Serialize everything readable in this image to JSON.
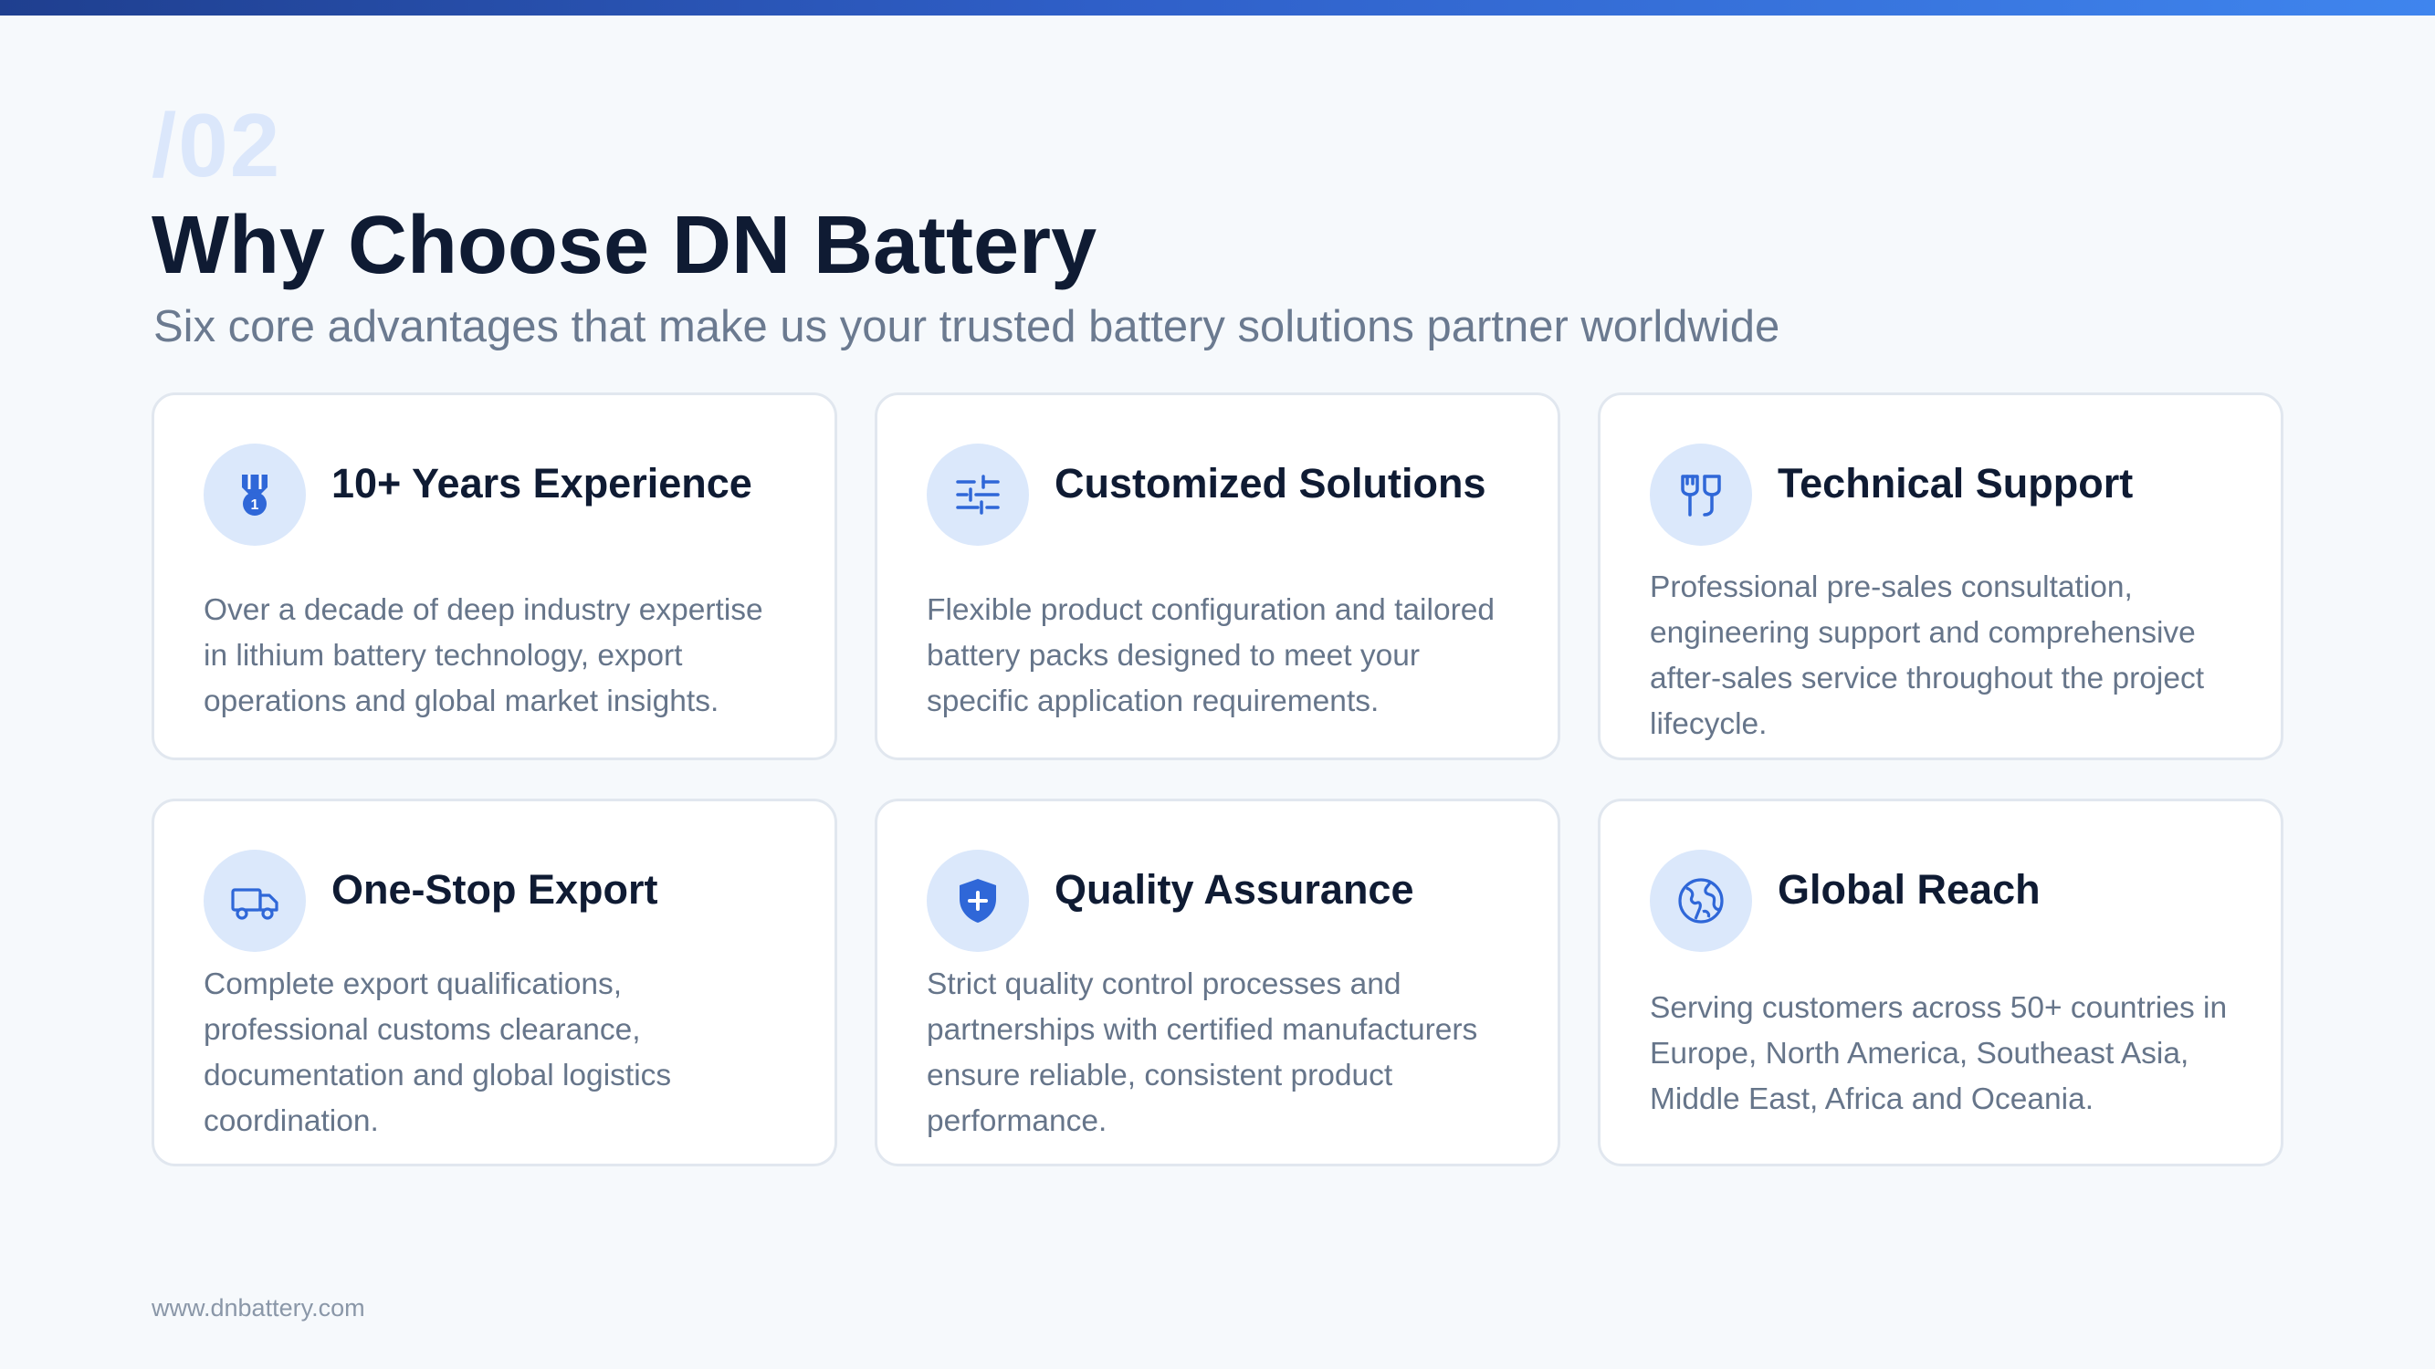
{
  "header": {
    "section_number": "/02",
    "title": "Why Choose DN Battery",
    "subtitle": "Six core advantages that make us your trusted battery solutions partner worldwide"
  },
  "cards": [
    {
      "icon": "medal-icon",
      "title": "10+ Years Experience",
      "description": "Over a decade of deep industry expertise in lithium battery technology, export operations and global market insights."
    },
    {
      "icon": "sliders-icon",
      "title": "Customized Solutions",
      "description": "Flexible product configuration and tailored battery packs designed to meet your specific application requirements."
    },
    {
      "icon": "plug-icon",
      "title": "Technical Support",
      "description": "Professional pre-sales consultation, engineering support and comprehensive after-sales service throughout the project lifecycle."
    },
    {
      "icon": "truck-icon",
      "title": "One-Stop Export",
      "description": "Complete export qualifications, professional customs clearance, documentation and global logistics coordination."
    },
    {
      "icon": "shield-plus-icon",
      "title": "Quality Assurance",
      "description": "Strict quality control processes and partnerships with certified manufacturers ensure reliable, consistent product performance."
    },
    {
      "icon": "globe-icon",
      "title": "Global Reach",
      "description": "Serving customers across 50+ countries in Europe, North America, Southeast Asia, Middle East, Africa and Oceania."
    }
  ],
  "footer": {
    "website": "www.dnbattery.com"
  },
  "colors": {
    "accent": "#2f67d8",
    "icon_background": "#dbe8fb",
    "title": "#0f1b33",
    "body_text": "#66758a",
    "section_number": "#dbe7fb"
  }
}
